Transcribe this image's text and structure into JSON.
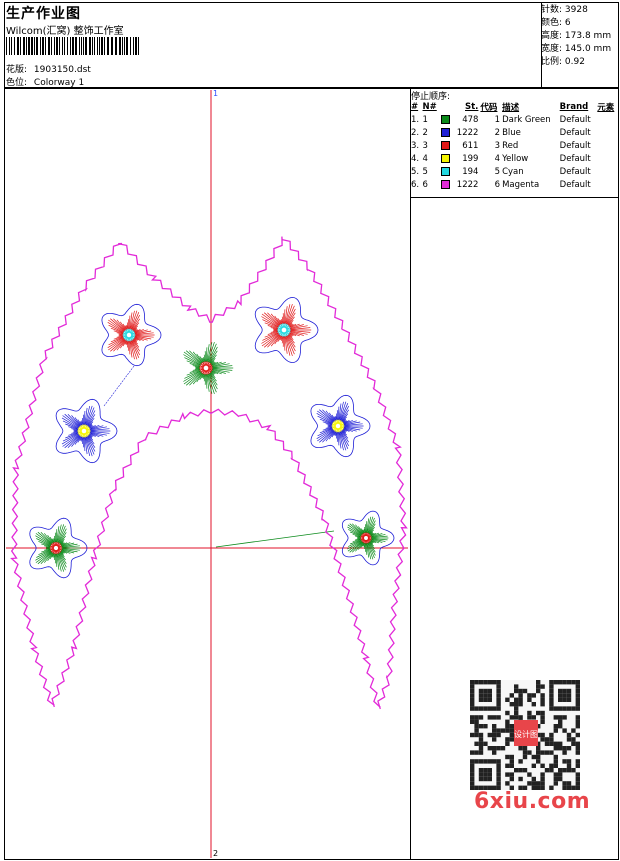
{
  "header": {
    "title": "生产作业图",
    "subtitle": "Wilcom(汇窝) 整饰工作室",
    "design_label": "花版:",
    "design_value": "1903150.dst",
    "colorway_label": "色位:",
    "colorway_value": "Colorway 1"
  },
  "stats": [
    {
      "label": "针数:",
      "value": "3928"
    },
    {
      "label": "颜色:",
      "value": "6"
    },
    {
      "label": "高度:",
      "value": "173.8 mm"
    },
    {
      "label": "宽度:",
      "value": "145.0 mm"
    },
    {
      "label": "比例:",
      "value": "0.92"
    }
  ],
  "axes": {
    "top_marker": "1",
    "bottom_marker": "2"
  },
  "stop_sequence": {
    "title": "停止顺序:",
    "columns": [
      "#",
      "N#",
      "St.",
      "代码",
      "描述",
      "Brand",
      "元素"
    ],
    "rows": [
      {
        "idx": "1.",
        "n": "1",
        "color": "#0a8a1a",
        "st": "478",
        "code": "1",
        "desc": "Dark Green",
        "brand": "Default",
        "elem": ""
      },
      {
        "idx": "2.",
        "n": "2",
        "color": "#1f1fd6",
        "st": "1222",
        "code": "2",
        "desc": "Blue",
        "brand": "Default",
        "elem": ""
      },
      {
        "idx": "3.",
        "n": "3",
        "color": "#e01818",
        "st": "611",
        "code": "3",
        "desc": "Red",
        "brand": "Default",
        "elem": ""
      },
      {
        "idx": "4.",
        "n": "4",
        "color": "#f5f500",
        "st": "199",
        "code": "4",
        "desc": "Yellow",
        "brand": "Default",
        "elem": ""
      },
      {
        "idx": "5.",
        "n": "5",
        "color": "#22d8e0",
        "st": "194",
        "code": "5",
        "desc": "Cyan",
        "brand": "Default",
        "elem": ""
      },
      {
        "idx": "6.",
        "n": "6",
        "color": "#e22ad8",
        "st": "1222",
        "code": "6",
        "desc": "Magenta",
        "brand": "Default",
        "elem": ""
      }
    ]
  },
  "watermark": {
    "site": "6xiu.com",
    "seal_chars": "设计图"
  }
}
